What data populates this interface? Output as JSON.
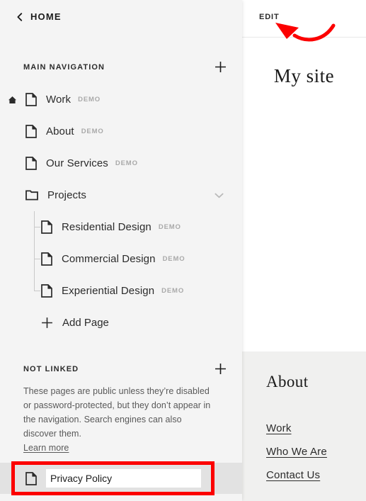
{
  "sidebar": {
    "back": {
      "label": "HOME",
      "icon": "chevron-left-icon"
    },
    "main_nav": {
      "title": "MAIN NAVIGATION",
      "add_icon": "plus-icon",
      "items": [
        {
          "label": "Work",
          "badge": "DEMO",
          "icon": "page-icon",
          "home": true,
          "level": 0
        },
        {
          "label": "About",
          "badge": "DEMO",
          "icon": "page-icon",
          "home": false,
          "level": 0
        },
        {
          "label": "Our Services",
          "badge": "DEMO",
          "icon": "page-icon",
          "home": false,
          "level": 0
        },
        {
          "label": "Projects",
          "badge": "",
          "icon": "folder-icon",
          "home": false,
          "level": 0,
          "collapse_icon": "chevron-down-icon"
        },
        {
          "label": "Residential Design",
          "badge": "DEMO",
          "icon": "page-icon",
          "home": false,
          "level": 1
        },
        {
          "label": "Commercial Design",
          "badge": "DEMO",
          "icon": "page-icon",
          "home": false,
          "level": 1
        },
        {
          "label": "Experiential Design",
          "badge": "DEMO",
          "icon": "page-icon",
          "home": false,
          "level": 1
        }
      ],
      "add_page": {
        "label": "Add Page",
        "icon": "plus-icon"
      }
    },
    "not_linked": {
      "title": "NOT LINKED",
      "add_icon": "plus-icon",
      "description": "These pages are public unless they’re disabled or password-protected, but they don’t appear in the navigation. Search engines can also discover them.",
      "learn_more": "Learn more"
    },
    "editing_page": {
      "icon": "page-icon",
      "value": "Privacy Policy",
      "placeholder": "Page Title"
    }
  },
  "preview": {
    "edit_label": "EDIT",
    "site_title": "My site",
    "about_heading": "About",
    "links": [
      {
        "label": "Work"
      },
      {
        "label": "Who We Are"
      },
      {
        "label": "Contact Us"
      }
    ]
  },
  "annotations": {
    "arrow_color": "#fc0000",
    "box_color": "#fc0000"
  }
}
